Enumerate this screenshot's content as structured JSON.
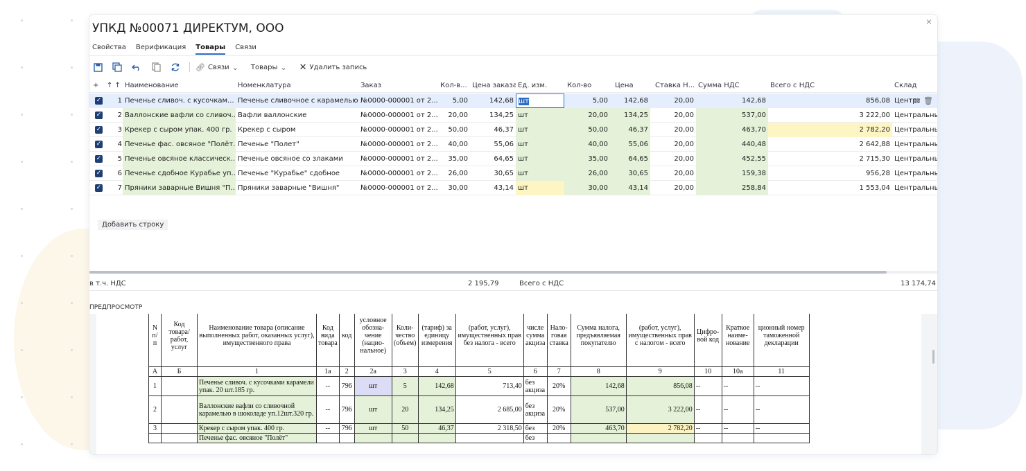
{
  "window": {
    "title": "УПКД №00071 ДИРЕКТУМ, ООО",
    "close_glyph": "×",
    "tabs": [
      "Свойства",
      "Верификация",
      "Товары",
      "Связи"
    ],
    "active_tab": "Товары"
  },
  "toolbar": {
    "links_label": "Связи",
    "goods_label": "Товары",
    "delete_label": "Удалить запись",
    "icons": [
      "save-icon",
      "save-as-icon",
      "undo-icon",
      "copy-icon",
      "refresh-icon",
      "link-icon",
      "chevron-down-icon",
      "close-icon"
    ]
  },
  "grid": {
    "headers": {
      "plus": "+",
      "sort": "↑ ↑",
      "name": "Наименование",
      "nomen": "Номенклатура",
      "order": "Заказ",
      "qty_order": "Кол-в...",
      "price_order": "Цена заказа",
      "unit": "Ед. изм.",
      "qty": "Кол-во",
      "price": "Цена",
      "vat_rate": "Ставка Н...",
      "vat_sum": "Сумма НДС",
      "total": "Всего с НДС",
      "warehouse": "Склад"
    },
    "rows": [
      {
        "n": "1",
        "name": "Печенье сливоч. с кусочкам...",
        "nomen": "Печенье сливочное с карамелью",
        "order": "№0000-000001 от 2...",
        "qty_order": "5,00",
        "price_order": "142,68",
        "unit": "шт",
        "qty": "5,00",
        "price": "142,68",
        "vat_rate": "20,00",
        "vat_sum": "142,68",
        "total": "856,08",
        "warehouse": "Центра"
      },
      {
        "n": "2",
        "name": "Валлонские вафли со сливоч...",
        "nomen": "Вафли валлонские",
        "order": "№0000-000001 от 2...",
        "qty_order": "20,00",
        "price_order": "134,25",
        "unit": "шт",
        "qty": "20,00",
        "price": "134,25",
        "vat_rate": "20,00",
        "vat_sum": "537,00",
        "total": "3 222,00",
        "warehouse": "Центральный скл"
      },
      {
        "n": "3",
        "name": "Крекер с сыром упак. 400 гр.",
        "nomen": "Крекер с сыром",
        "order": "№0000-000001 от 2...",
        "qty_order": "50,00",
        "price_order": "46,37",
        "unit": "шт",
        "qty": "50,00",
        "price": "46,37",
        "vat_rate": "20,00",
        "vat_sum": "463,70",
        "total": "2 782,20",
        "warehouse": "Центральный скл"
      },
      {
        "n": "4",
        "name": "Печенье фас. овсяное \"Полёт...",
        "nomen": "Печенье \"Полет\"",
        "order": "№0000-000001 от 2...",
        "qty_order": "40,00",
        "price_order": "55,06",
        "unit": "шт",
        "qty": "40,00",
        "price": "55,06",
        "vat_rate": "20,00",
        "vat_sum": "440,48",
        "total": "2 642,88",
        "warehouse": "Центральный скл"
      },
      {
        "n": "5",
        "name": "Печенье овсяное классическ...",
        "nomen": "Печенье овсяное со злаками",
        "order": "№0000-000001 от 2...",
        "qty_order": "35,00",
        "price_order": "64,65",
        "unit": "шт",
        "qty": "35,00",
        "price": "64,65",
        "vat_rate": "20,00",
        "vat_sum": "452,55",
        "total": "2 715,30",
        "warehouse": "Центральный скл"
      },
      {
        "n": "6",
        "name": "Печенье сдобное Курабье уп...",
        "nomen": "Печенье \"Курабье\" сдобное",
        "order": "№0000-000001 от 2...",
        "qty_order": "26,00",
        "price_order": "30,65",
        "unit": "шт",
        "qty": "26,00",
        "price": "30,65",
        "vat_rate": "20,00",
        "vat_sum": "159,38",
        "total": "956,28",
        "warehouse": "Центральный скл"
      },
      {
        "n": "7",
        "name": "Пряники заварные Вишня \"П...",
        "nomen": "Пряники заварные \"Вишня\"",
        "order": "№0000-000001 от 2...",
        "qty_order": "30,00",
        "price_order": "43,14",
        "unit": "шт",
        "qty": "30,00",
        "price": "43,14",
        "vat_rate": "20,00",
        "vat_sum": "258,84",
        "total": "1 553,04",
        "warehouse": "Центральный скл"
      }
    ],
    "add_row": "Добавить строку"
  },
  "totals": {
    "vat_label": "в т.ч. НДС",
    "vat_value": "2 195,79",
    "total_label": "Всего с НДС",
    "total_value": "13 174,74"
  },
  "preview": {
    "label": "ПРЕДПРОСМОТР",
    "head": [
      "N п/п",
      "Код товара/ работ, услуг",
      "Наименование товара (описание выполненных работ, оказанных услуг), имущественного права",
      "Код вида товара",
      "код",
      "условное обозна- чение (нацио- нальное)",
      "Коли- чество (объем)",
      "(тариф) за единицу измерения",
      "(работ, услуг), имущественных прав без налога - всего",
      "числе сумма акциза",
      "Нало- говая ставка",
      "Сумма налога, предъявляемая покупателю",
      "(работ, услуг), имущественных прав с налогом - всего",
      "Цифро- вой код",
      "Краткое наиме- нование",
      "ционный номер таможенной декларации"
    ],
    "index": [
      "А",
      "Б",
      "1",
      "1а",
      "2",
      "2а",
      "3",
      "4",
      "5",
      "6",
      "7",
      "8",
      "9",
      "10",
      "10а",
      "11"
    ],
    "rows": [
      [
        "1",
        "",
        "Печенье сливоч. с кусочками карамели упак. 20 шт.185 гр.",
        "--",
        "796",
        "шт",
        "5",
        "142,68",
        "713,40",
        "без акциза",
        "20%",
        "142,68",
        "856,08",
        "--",
        "--",
        "--"
      ],
      [
        "2",
        "",
        "Валлонские вафли со сливочной карамелью в шоколаде уп.12шт.320 гр.",
        "--",
        "796",
        "шт",
        "20",
        "134,25",
        "2 685,00",
        "без акциза",
        "20%",
        "537,00",
        "3 222,00",
        "--",
        "--",
        "--"
      ],
      [
        "3",
        "",
        "Крекер с сыром упак. 400 гр.",
        "--",
        "796",
        "шт",
        "50",
        "46,37",
        "2 318,50",
        "без",
        "20%",
        "463,70",
        "2 782,20",
        "--",
        "--",
        "--"
      ],
      [
        "",
        "",
        "Печенье фас. овсяное \"Полёт\"",
        "",
        "",
        "",
        "",
        "",
        "",
        "без",
        "",
        "",
        "",
        "",
        "",
        ""
      ]
    ]
  }
}
